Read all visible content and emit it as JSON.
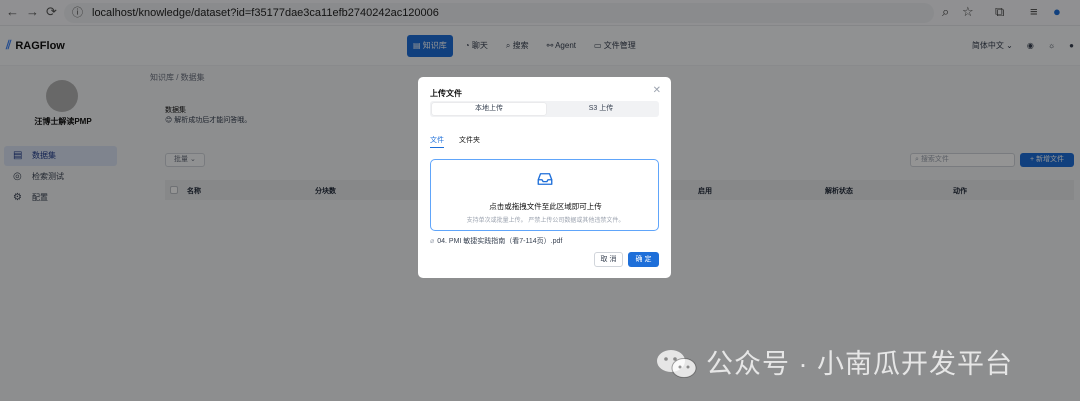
{
  "browser": {
    "url": "localhost/knowledge/dataset?id=f35177dae3ca11efb2740242ac120006"
  },
  "header": {
    "logo": "RAGFlow",
    "nav": [
      "知识库",
      "聊天",
      "搜索",
      "Agent",
      "文件管理"
    ],
    "language": "简体中文"
  },
  "sidebar": {
    "kb_name": "汪博士解读PMP",
    "items": [
      {
        "label": "数据集",
        "icon": "document-icon"
      },
      {
        "label": "检索测试",
        "icon": "target-icon"
      },
      {
        "label": "配置",
        "icon": "gear-icon"
      }
    ]
  },
  "main": {
    "breadcrumb": "知识库 / 数据集",
    "title": "数据集",
    "hint": "解析成功后才能问答哦。",
    "filter": "批量",
    "search_placeholder": "搜索文件",
    "new_button": "+ 新增文件",
    "columns": [
      "名称",
      "分块数",
      "启用",
      "解析状态",
      "动作"
    ]
  },
  "modal": {
    "title": "上传文件",
    "segments": [
      "本地上传",
      "S3 上传"
    ],
    "tabs": [
      "文件",
      "文件夹"
    ],
    "drop_main": "点击或拖拽文件至此区域即可上传",
    "drop_sub": "支持单次或批量上传。 严禁上传公司数据或其他违禁文件。",
    "file_name": "04. PMI 敏捷实践指南（看7-114页）.pdf",
    "cancel": "取 消",
    "ok": "确 定"
  },
  "watermark": "公众号 · 小南瓜开发平台",
  "colors": {
    "accent": "#1e6fd9",
    "drop_border": "#60a5fa"
  }
}
